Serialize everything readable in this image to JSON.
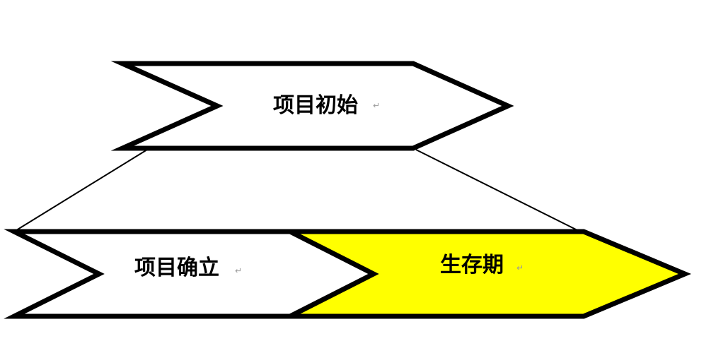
{
  "diagram": {
    "nodes": [
      {
        "id": "initiation",
        "label": "项目初始",
        "fill": "#ffffff"
      },
      {
        "id": "establishment",
        "label": "项目确立",
        "fill": "#ffffff"
      },
      {
        "id": "lifecycle",
        "label": "生存期",
        "fill": "#ffff00"
      }
    ],
    "edges": [
      {
        "from": "initiation",
        "to": "establishment"
      },
      {
        "from": "initiation",
        "to": "lifecycle"
      }
    ],
    "stroke_color": "#000000",
    "paragraph_mark": "↵"
  }
}
